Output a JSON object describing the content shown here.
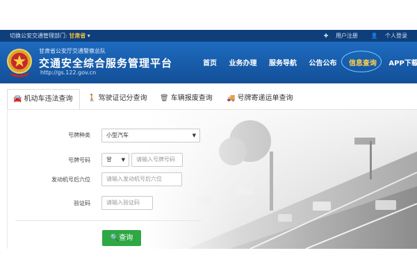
{
  "topbar": {
    "switch_label": "切换公安交通管理部门:",
    "switch_value": "甘肃省",
    "register": "用户注册",
    "personal_login": "个人登录"
  },
  "header": {
    "subtitle": "甘肃省公安厅交通警察总队",
    "title": "交通安全综合服务管理平台",
    "url": "http://gs.122.gov.cn",
    "nav": [
      "首页",
      "业务办理",
      "服务导航",
      "公告公布",
      "信息查询",
      "APP下载"
    ],
    "active_nav_index": 4
  },
  "tabs": [
    {
      "label": "机动车违法查询",
      "icon": "car-icon"
    },
    {
      "label": "驾驶证记分查询",
      "icon": "person-icon"
    },
    {
      "label": "车辆报废查询",
      "icon": "trash-icon"
    },
    {
      "label": "号牌寄递运单查询",
      "icon": "truck-icon"
    }
  ],
  "form": {
    "plate_type_label": "号牌种类",
    "plate_type_value": "小型汽车",
    "plate_no_label": "号牌号码",
    "province_value": "甘",
    "plate_no_placeholder": "请输入号牌号码",
    "engine_label": "发动机号后六位",
    "engine_placeholder": "请输入发动机号后六位",
    "captcha_label": "验证码",
    "captcha_placeholder": "请输入验证码",
    "query_button": "查询"
  },
  "colors": {
    "header_blue": "#1e6bc0",
    "topbar_blue": "#0f3f7a",
    "active_nav": "#ffd24a",
    "query_green": "#2ea843"
  }
}
